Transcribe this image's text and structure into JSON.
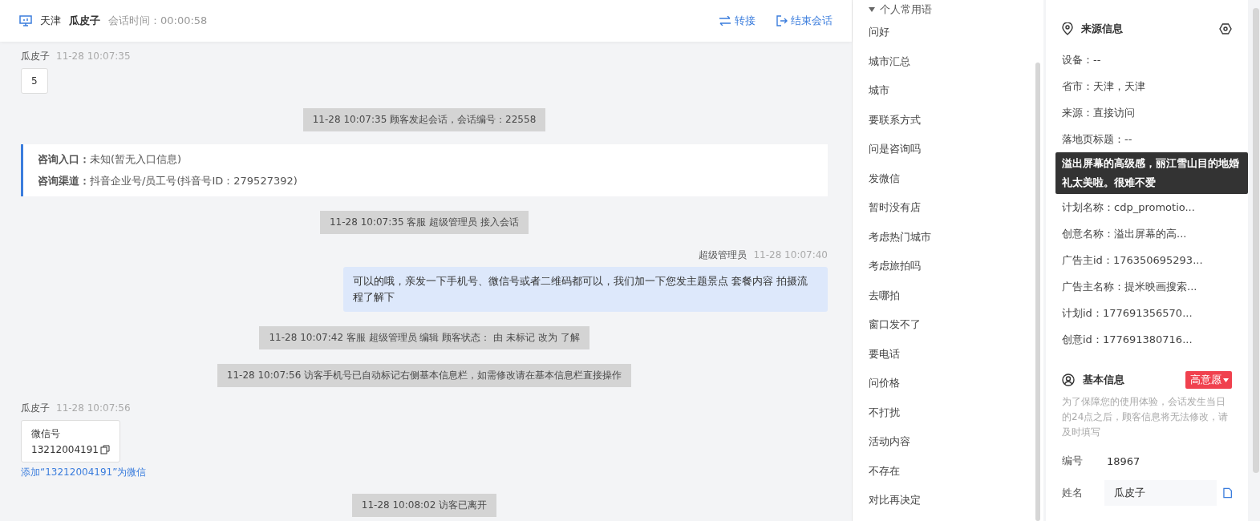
{
  "header": {
    "location": "天津",
    "visitor": "瓜皮子",
    "time_label": "会话时间：",
    "time": "00:00:58",
    "actions": [
      {
        "kind": "transfer",
        "label": "转接"
      },
      {
        "kind": "end",
        "label": "结束会话"
      }
    ]
  },
  "messages": [
    {
      "kind": "customer",
      "name": "瓜皮子",
      "time": "11-28 10:07:35",
      "text": "5"
    },
    {
      "kind": "system",
      "text": "11-28 10:07:35 顾客发起会话，会话编号：22558"
    },
    {
      "kind": "info",
      "lines": [
        {
          "label": "咨询入口：",
          "value": "未知(暂无入口信息)"
        },
        {
          "label": "咨询渠道：",
          "value": "抖音企业号/员工号(抖音号ID：279527392)"
        }
      ]
    },
    {
      "kind": "system",
      "text": "11-28 10:07:35 客服 超级管理员 接入会话"
    },
    {
      "kind": "agent",
      "name": "超级管理员",
      "time": "11-28 10:07:40",
      "text": "可以的哦，亲发一下手机号、微信号或者二维码都可以，我们加一下您发主题景点 套餐内容 拍摄流程了解下"
    },
    {
      "kind": "system",
      "text": "11-28 10:07:42 客服 超级管理员 编辑 顾客状态： 由 未标记 改为 了解"
    },
    {
      "kind": "system",
      "text": "11-28 10:07:56 访客手机号已自动标记右侧基本信息栏，如需修改请在基本信息栏直接操作"
    },
    {
      "kind": "contact",
      "name": "瓜皮子",
      "time": "11-28 10:07:56",
      "label": "微信号",
      "number": "13212004191",
      "link": "添加“13212004191”为微信"
    },
    {
      "kind": "system",
      "text": "11-28 10:08:02 访客已离开"
    }
  ],
  "phrases": {
    "group": {
      "label": "个人常用语",
      "expanded": true
    },
    "items": [
      "问好",
      "城市汇总",
      "城市",
      "要联系方式",
      "问是咨询吗",
      "发微信",
      "暂时没有店",
      "考虑热门城市",
      "考虑旅拍吗",
      "去哪拍",
      "窗口发不了",
      "要电话",
      "问价格",
      "不打扰",
      "活动内容",
      "不存在",
      "对比再决定"
    ]
  },
  "source": {
    "title": "来源信息",
    "rows_top": [
      "设备：--",
      "省市：天津，天津",
      "来源：直接访问",
      "落地页标题：--"
    ],
    "tooltip": "溢出屏幕的高级感，丽江雪山目的地婚礼太美啦。很难不爱",
    "rows_bottom": [
      {
        "label": "计划名称：",
        "value": "cdp_promotio..."
      },
      {
        "label": "创意名称：",
        "value": "溢出屏幕的高..."
      },
      {
        "label": "广告主id：",
        "value": "176350695293..."
      },
      {
        "label": "广告主名称：",
        "value": "提米映画搜索..."
      },
      {
        "label": "计划id：",
        "value": "177691356570..."
      },
      {
        "label": "创意id：",
        "value": "177691380716..."
      }
    ]
  },
  "basic": {
    "title": "基本信息",
    "tag": "高意愿",
    "note": "为了保障您的使用体验，会话发生当日的24点之后，顾客信息将无法修改，请及时填写",
    "fields": [
      {
        "kind": "text",
        "label": "编号",
        "value": "18967"
      },
      {
        "kind": "input",
        "label": "姓名",
        "value": "瓜皮子"
      }
    ]
  }
}
